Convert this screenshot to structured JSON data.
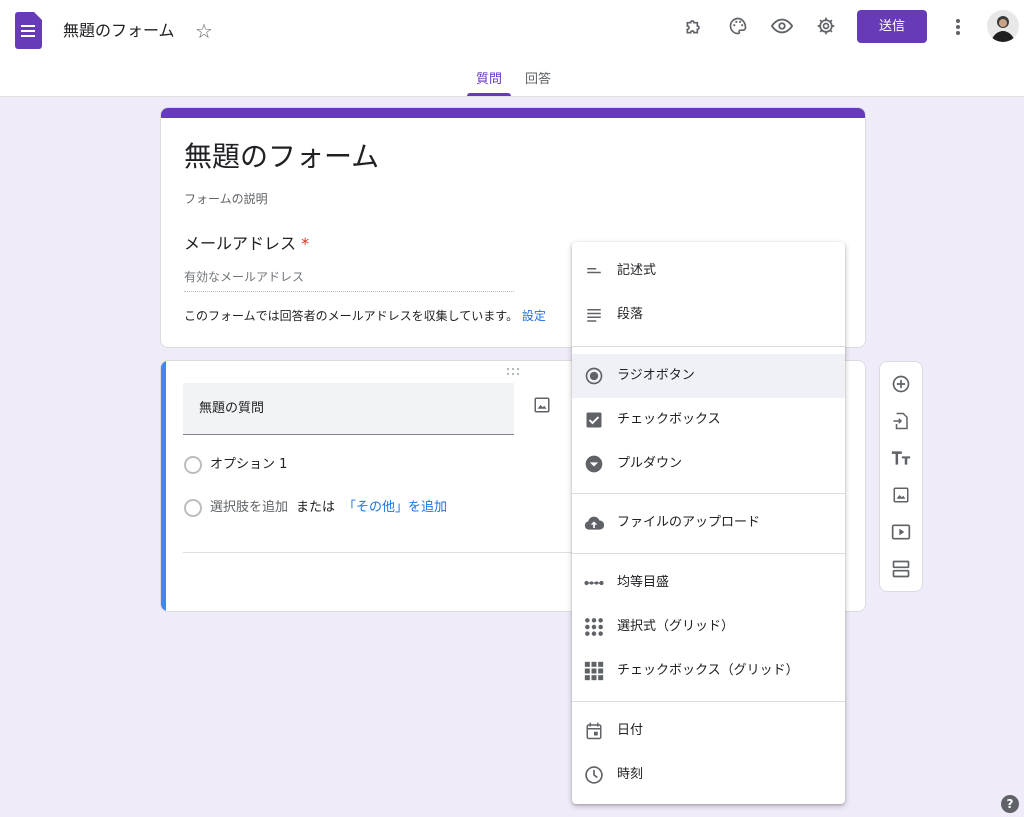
{
  "header": {
    "title": "無題のフォーム",
    "send_label": "送信",
    "icons": [
      "puzzle-icon",
      "palette-icon",
      "eye-icon",
      "gear-icon",
      "more-vert-icon"
    ]
  },
  "tabs": [
    {
      "label": "質問",
      "active": true
    },
    {
      "label": "回答",
      "active": false
    }
  ],
  "form": {
    "title": "無題のフォーム",
    "description": "フォームの説明",
    "email_label": "メールアドレス",
    "required_mark": "*",
    "email_placeholder": "有効なメールアドレス",
    "collect_note": "このフォームでは回答者のメールアドレスを収集しています。",
    "settings_link": "設定"
  },
  "question": {
    "title": "無題の質問",
    "option1": "オプション 1",
    "add_option": "選択肢を追加",
    "or_text": "または",
    "add_other": "「その他」を追加"
  },
  "menu": {
    "items": [
      {
        "label": "記述式",
        "icon": "short-text-icon",
        "selected": false
      },
      {
        "label": "段落",
        "icon": "paragraph-icon",
        "selected": false
      },
      {
        "label": "ラジオボタン",
        "icon": "radio-button-icon",
        "selected": true
      },
      {
        "label": "チェックボックス",
        "icon": "checkbox-icon",
        "selected": false
      },
      {
        "label": "プルダウン",
        "icon": "dropdown-icon",
        "selected": false
      },
      {
        "label": "ファイルのアップロード",
        "icon": "cloud-upload-icon",
        "selected": false
      },
      {
        "label": "均等目盛",
        "icon": "linear-scale-icon",
        "selected": false
      },
      {
        "label": "選択式（グリッド）",
        "icon": "grid-dots-icon",
        "selected": false
      },
      {
        "label": "チェックボックス（グリッド）",
        "icon": "grid-squares-icon",
        "selected": false
      },
      {
        "label": "日付",
        "icon": "calendar-icon",
        "selected": false
      },
      {
        "label": "時刻",
        "icon": "clock-icon",
        "selected": false
      }
    ]
  },
  "toolbar": {
    "icons": [
      "add-question-icon",
      "import-questions-icon",
      "add-title-icon",
      "add-image-icon",
      "add-video-icon",
      "add-section-icon"
    ]
  },
  "help": "?",
  "colors": {
    "accent": "#673ab7",
    "background": "#f0ebf8",
    "link": "#1a73e8",
    "active_border": "#4285f4"
  }
}
